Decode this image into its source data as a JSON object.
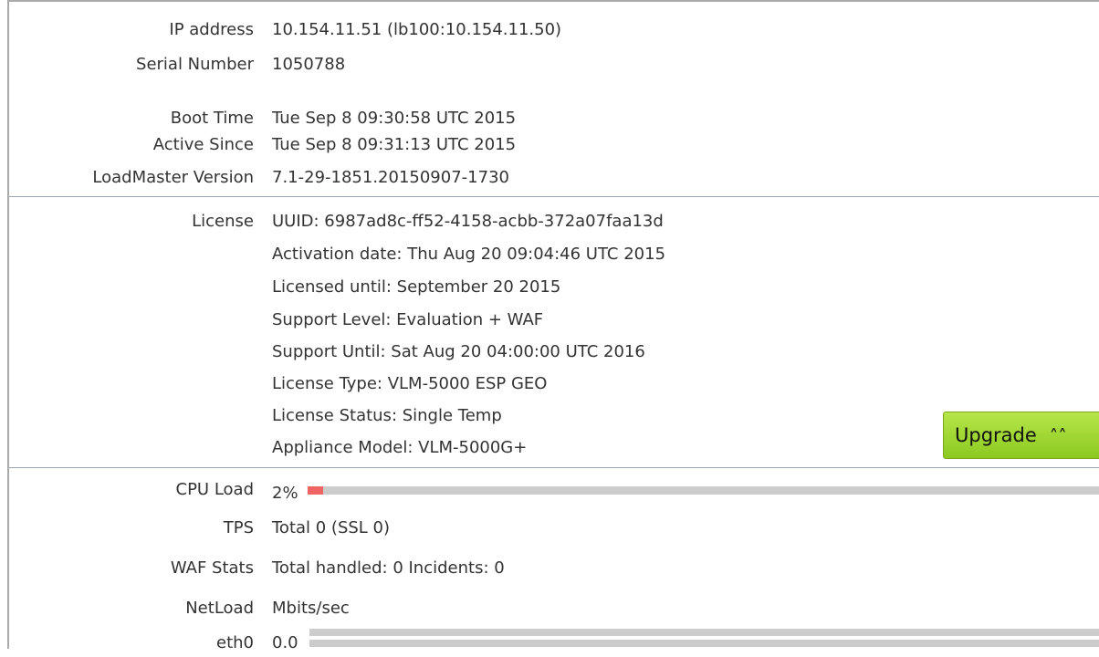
{
  "system": {
    "ip_address": {
      "label": "IP address",
      "value": "10.154.11.51 (lb100:10.154.11.50)"
    },
    "serial_number": {
      "label": "Serial Number",
      "value": "1050788"
    },
    "boot_time": {
      "label": "Boot Time",
      "value": "Tue Sep 8 09:30:58 UTC 2015"
    },
    "active_since": {
      "label": "Active Since",
      "value": "Tue Sep 8 09:31:13 UTC 2015"
    },
    "loadmaster_version": {
      "label": "LoadMaster Version",
      "value": "7.1-29-1851.20150907-1730"
    }
  },
  "license": {
    "label": "License",
    "lines": [
      "UUID: 6987ad8c-ff52-4158-acbb-372a07faa13d",
      "Activation date: Thu Aug 20 09:04:46 UTC 2015",
      "Licensed until: September 20 2015",
      "Support Level: Evaluation + WAF",
      "Support Until: Sat Aug 20 04:00:00 UTC 2016",
      "License Type: VLM-5000 ESP GEO",
      "License Status: Single Temp",
      "Appliance Model: VLM-5000G+"
    ],
    "upgrade_label": "Upgrade",
    "upgrade_icon": "double-chevron-up-icon",
    "upgrade_glyph": "≈"
  },
  "stats": {
    "cpu_load": {
      "label": "CPU Load",
      "value": "2%",
      "fraction": 0.02,
      "fill_color": "#f06464"
    },
    "tps": {
      "label": "TPS",
      "value": "Total 0 (SSL 0)"
    },
    "waf_stats": {
      "label": "WAF Stats",
      "value": "Total handled: 0 Incidents: 0"
    },
    "netload": {
      "label": "NetLoad",
      "value": "Mbits/sec"
    },
    "eth0": {
      "label": "eth0",
      "value": "0.0"
    }
  }
}
